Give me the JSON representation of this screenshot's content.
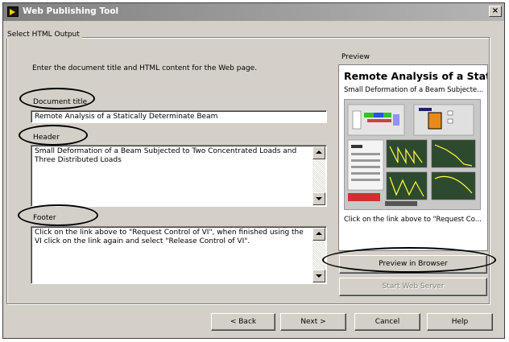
{
  "window": {
    "title": "Web Publishing Tool",
    "close_glyph": "×"
  },
  "group": {
    "label": "Select HTML Output"
  },
  "instructions": "Enter the document title and HTML content for the Web page.",
  "document_title": {
    "label": "Document title",
    "value": "Remote Analysis of a Statically Determinate Beam"
  },
  "header_field": {
    "label": "Header",
    "value": "Small Deformation of a Beam Subjected to Two Concentrated Loads and Three Distributed Loads"
  },
  "footer_field": {
    "label": "Footer",
    "value": "Click on the link above to \"Request Control of VI\", when finished using the VI click on the link again and select \"Release Control of VI\"."
  },
  "preview": {
    "label": "Preview",
    "title": "Remote Analysis of a Static...",
    "header": "Small Deformation of a Beam Subjecte...",
    "footer": "Click on the link above to \"Request Co..."
  },
  "buttons": {
    "preview_in_browser": "Preview in Browser",
    "start_web_server": "Start Web Server",
    "back": "< Back",
    "next": "Next >",
    "cancel": "Cancel",
    "help": "Help"
  },
  "icons": {
    "app": "labview-app-icon",
    "close": "close-icon"
  },
  "colors": {
    "titlebar_start": "#808080",
    "titlebar_end": "#b5b5b5",
    "window_bg": "#d4d0c8",
    "annotation": "#000000"
  }
}
